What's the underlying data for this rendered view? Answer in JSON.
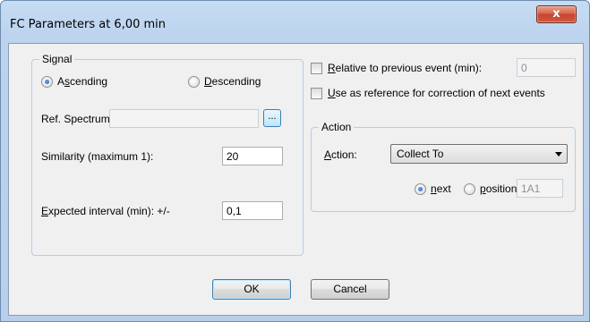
{
  "window": {
    "title": "FC Parameters at 6,00 min",
    "close_glyph": "x"
  },
  "signal": {
    "legend": "Signal",
    "ascending": {
      "pre": "A",
      "accel": "s",
      "post": "cending",
      "checked": true
    },
    "descending": {
      "pre": "",
      "accel": "D",
      "post": "escending",
      "checked": false
    },
    "ref_spectrum_label": "Ref. Spectrum:",
    "ref_spectrum_value": "",
    "browse_label": "...",
    "similarity_label": "Similarity (maximum 1):",
    "similarity_value": "20",
    "expected": {
      "pre": "",
      "accel": "E",
      "post": "xpected interval (min): +/-"
    },
    "expected_value": "0,1"
  },
  "relative": {
    "pre": "",
    "accel": "R",
    "post": "elative to previous event (min):",
    "checked": false,
    "value": "0"
  },
  "use_reference": {
    "pre": "",
    "accel": "U",
    "post": "se as reference for correction of next events",
    "checked": false
  },
  "action": {
    "legend": "Action",
    "label": {
      "pre": "",
      "accel": "A",
      "post": "ction:"
    },
    "selected": "Collect To",
    "next": {
      "pre": "",
      "accel": "n",
      "post": "ext",
      "checked": true
    },
    "position": {
      "pre": "",
      "accel": "p",
      "post": "osition",
      "checked": false
    },
    "position_value": "1A1"
  },
  "buttons": {
    "ok": "OK",
    "cancel": "Cancel"
  }
}
